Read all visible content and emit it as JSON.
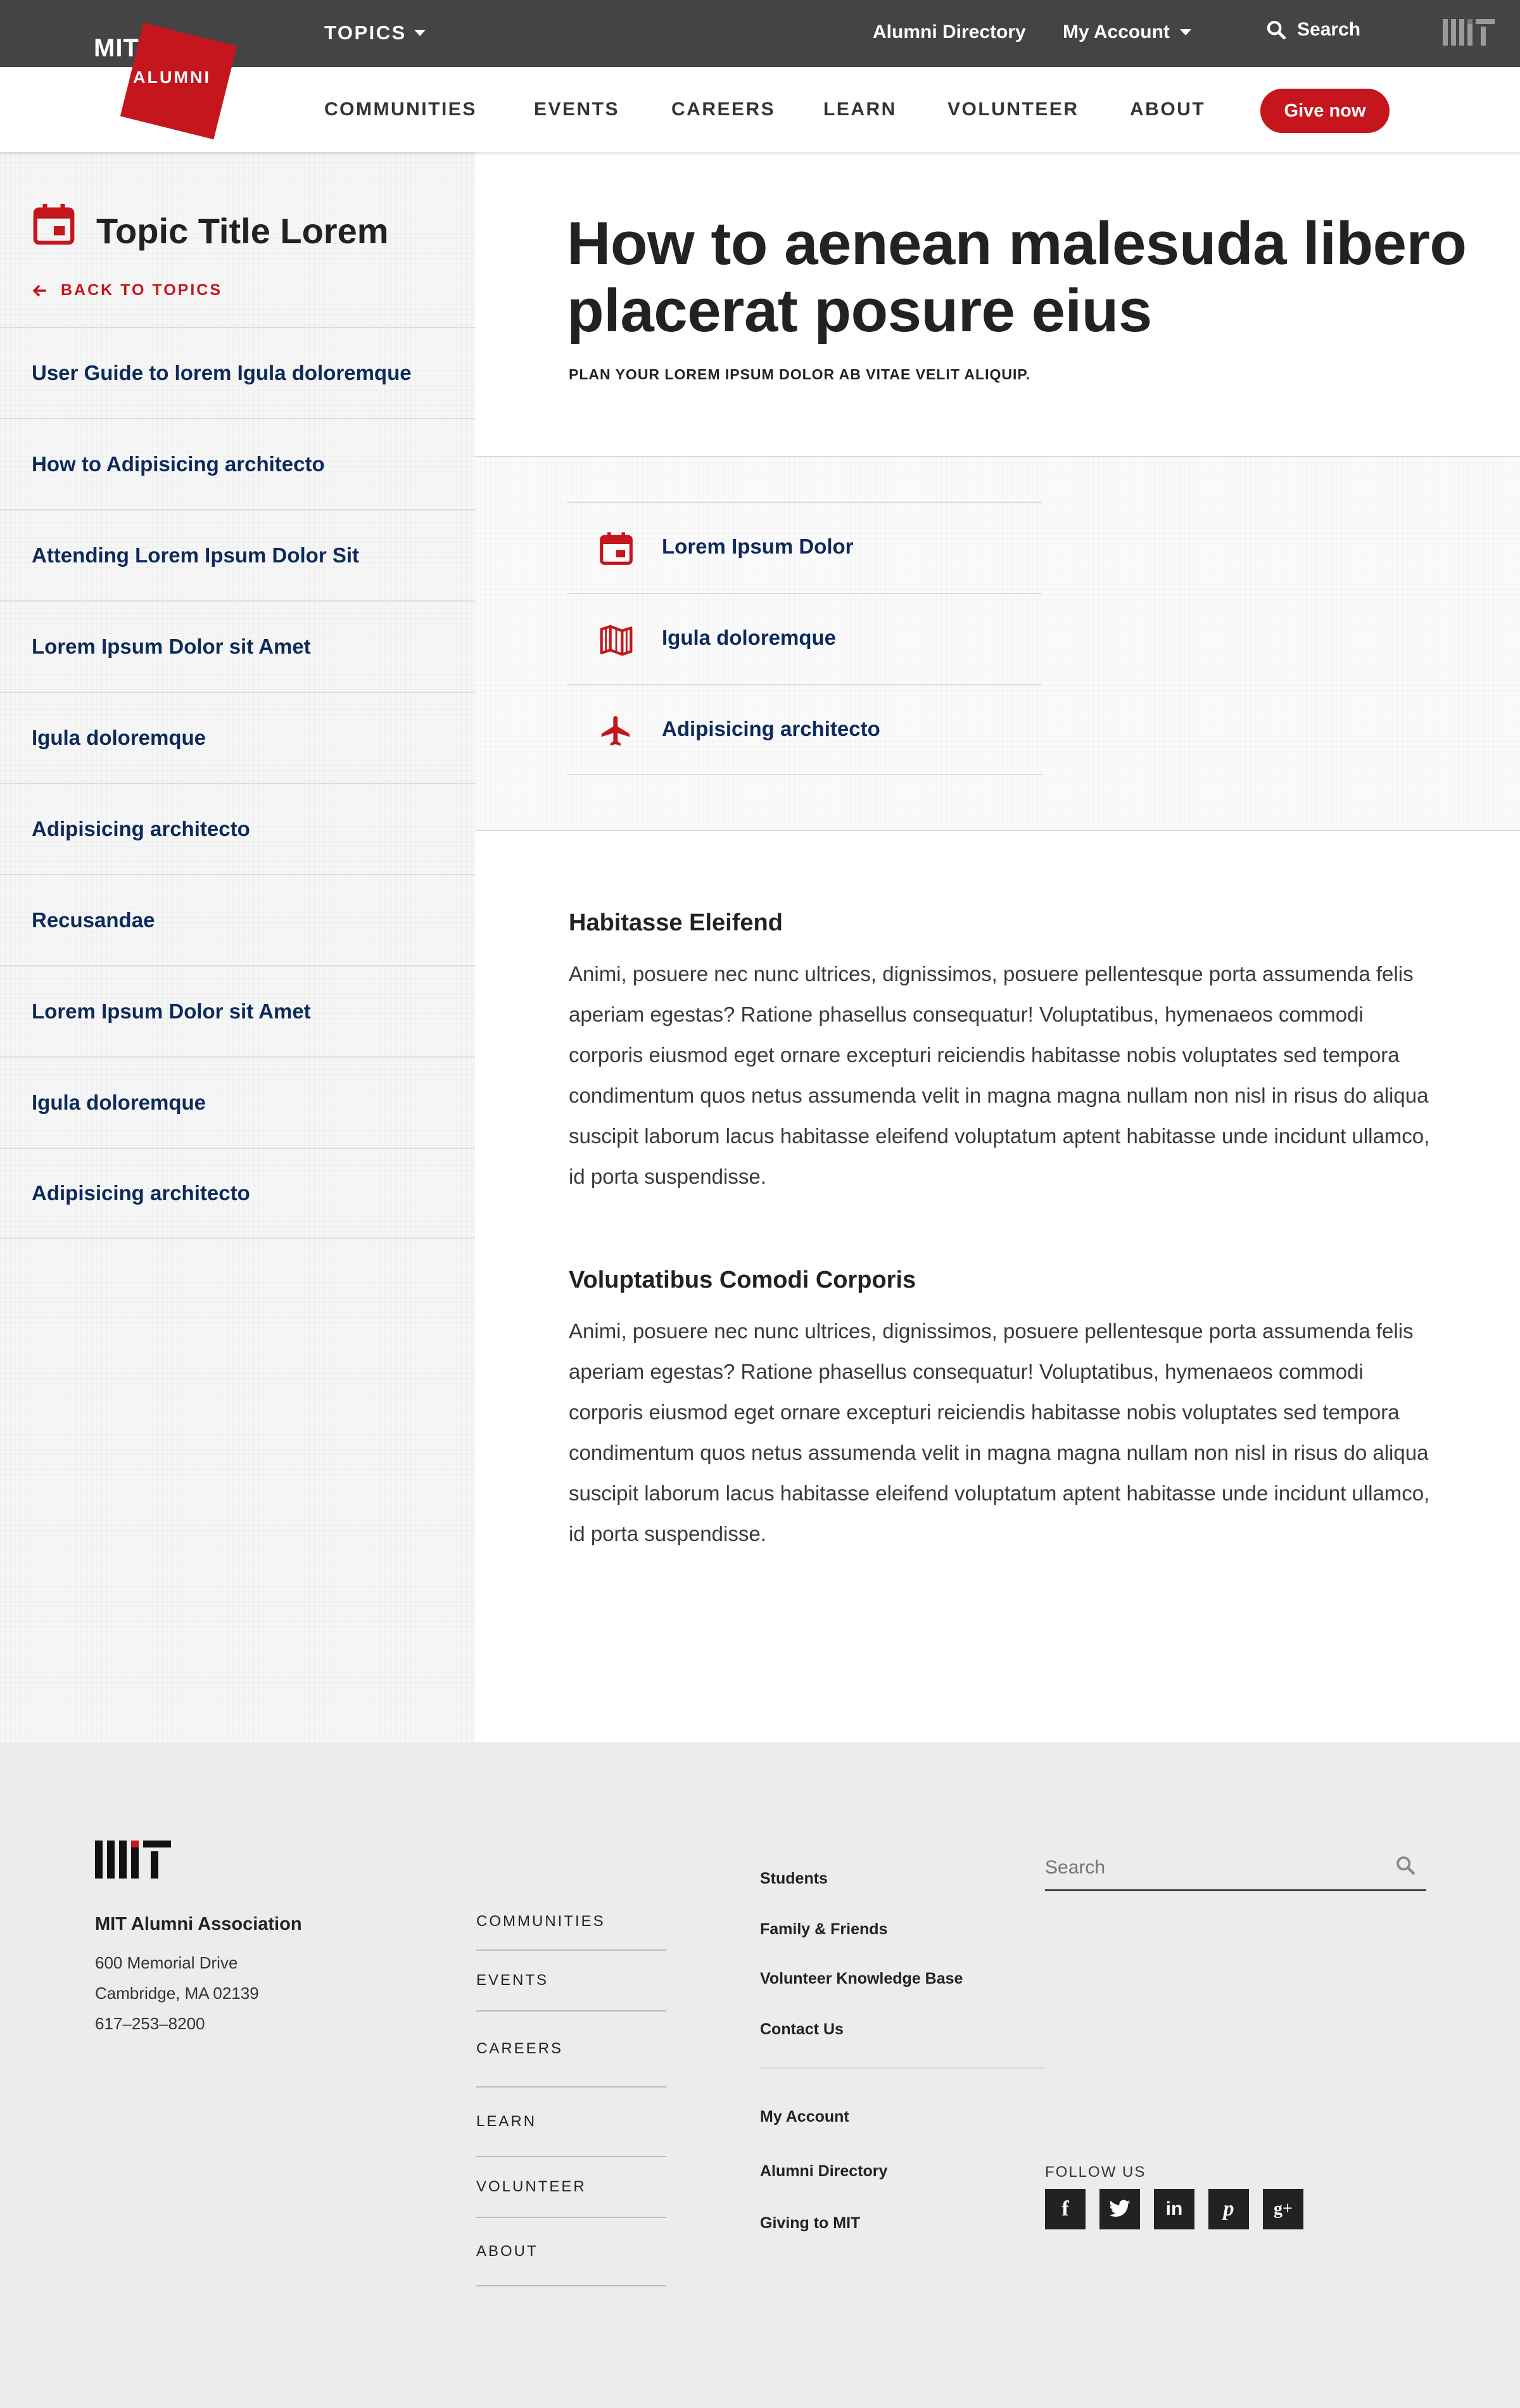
{
  "header": {
    "topics_label": "TOPICS",
    "alumni_directory": "Alumni Directory",
    "my_account": "My Account",
    "search": "Search",
    "logo_mit": "MIT",
    "logo_alumni": "ALUMNI",
    "nav": [
      "COMMUNITIES",
      "EVENTS",
      "CAREERS",
      "LEARN",
      "VOLUNTEER",
      "ABOUT"
    ],
    "give_now": "Give now"
  },
  "sidebar": {
    "title": "Topic Title Lorem",
    "back_link": "BACK TO TOPICS",
    "items": [
      {
        "label": "User Guide to lorem Igula doloremque"
      },
      {
        "label": "How to Adipisicing architecto"
      },
      {
        "label": "Attending Lorem Ipsum Dolor Sit"
      },
      {
        "label": "Lorem Ipsum Dolor sit Amet"
      },
      {
        "label": "Igula doloremque"
      },
      {
        "label": "Adipisicing architecto"
      },
      {
        "label": "Recusandae"
      },
      {
        "label": "Lorem Ipsum Dolor sit Amet"
      },
      {
        "label": "Igula doloremque"
      },
      {
        "label": "Adipisicing architecto"
      }
    ]
  },
  "hero": {
    "title": "How to aenean malesuda libero placerat posure eius",
    "subtitle": "PLAN YOUR LOREM IPSUM DOLOR AB VITAE VELIT ALIQUIP."
  },
  "quick_links": [
    {
      "label": "Lorem Ipsum Dolor",
      "icon": "calendar-icon"
    },
    {
      "label": "Igula doloremque",
      "icon": "map-icon"
    },
    {
      "label": "Adipisicing architecto",
      "icon": "airplane-icon"
    }
  ],
  "sections": [
    {
      "heading": "Habitasse Eleifend",
      "body": "Animi, posuere nec nunc ultrices, dignissimos, posuere pellentesque porta assumenda felis aperiam egestas? Ratione phasellus consequatur! Voluptatibus, hymenaeos commodi corporis eiusmod eget ornare excepturi reiciendis habitasse nobis voluptates sed tempora condimentum quos netus assumenda velit in magna magna nullam non nisl in risus do aliqua suscipit laborum lacus habitasse eleifend voluptatum aptent habitasse unde incidunt ullamco, id porta suspendisse."
    },
    {
      "heading": "Voluptatibus Comodi Corporis",
      "body": "Animi, posuere nec nunc ultrices, dignissimos, posuere pellentesque porta assumenda felis aperiam egestas? Ratione phasellus consequatur! Voluptatibus, hymenaeos commodi corporis eiusmod eget ornare excepturi reiciendis habitasse nobis voluptates sed tempora condimentum quos netus assumenda velit in magna magna nullam non nisl in risus do aliqua suscipit laborum lacus habitasse eleifend voluptatum aptent habitasse unde incidunt ullamco, id porta suspendisse."
    }
  ],
  "footer": {
    "org_name": "MIT Alumni Association",
    "address_line1": "600 Memorial Drive",
    "address_line2": "Cambridge, MA 02139",
    "phone": "617–253–8200",
    "nav": [
      "COMMUNITIES",
      "EVENTS",
      "CAREERS",
      "LEARN",
      "VOLUNTEER",
      "ABOUT"
    ],
    "links_group1": [
      "Students",
      "Family & Friends",
      "Volunteer Knowledge Base",
      "Contact Us"
    ],
    "links_group2": [
      "My Account",
      "Alumni Directory",
      "Giving to MIT"
    ],
    "search_placeholder": "Search",
    "follow_us": "FOLLOW US",
    "social": [
      {
        "name": "facebook-icon",
        "glyph": "f"
      },
      {
        "name": "twitter-icon",
        "glyph": "t"
      },
      {
        "name": "linkedin-icon",
        "glyph": "in"
      },
      {
        "name": "pinterest-icon",
        "glyph": "p"
      },
      {
        "name": "google-plus-icon",
        "glyph": "g+"
      }
    ]
  },
  "colors": {
    "brand_red": "#c4161c",
    "link_navy": "#0c2a5a",
    "topbar": "#444444",
    "footer_bg": "#ececeb"
  }
}
